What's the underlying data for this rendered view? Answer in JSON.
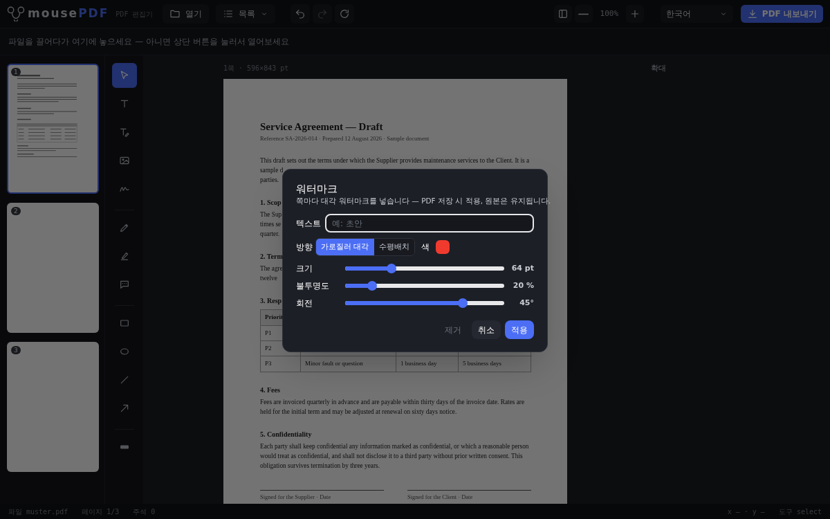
{
  "app": {
    "logo_first": "mouse",
    "logo_second": "PDF",
    "subtitle": "PDF 편집기"
  },
  "toolbar": {
    "open": "열기",
    "list": "목록",
    "zoom": "100%",
    "language": "한국어",
    "export": "PDF 내보내기"
  },
  "hint_bar": "파일을 끌어다가 여기에 놓으세요 — 아니면 상단 버튼을 눌러서 열어보세요",
  "thumbnails": [
    {
      "number": "1",
      "selected": true,
      "kind": "document"
    },
    {
      "number": "2",
      "selected": false,
      "kind": "blank"
    },
    {
      "number": "3",
      "selected": false,
      "kind": "blank"
    }
  ],
  "tool_groups": [
    [
      {
        "kind": "select",
        "selected": true
      },
      {
        "kind": "text",
        "selected": false
      },
      {
        "kind": "edit-text",
        "selected": false
      },
      {
        "kind": "image",
        "selected": false
      },
      {
        "kind": "signature",
        "selected": false
      }
    ],
    [
      {
        "kind": "pen",
        "selected": false
      },
      {
        "kind": "highlighter",
        "selected": false
      },
      {
        "kind": "comment",
        "selected": false
      }
    ],
    [
      {
        "kind": "rectangle",
        "selected": false
      },
      {
        "kind": "ellipse",
        "selected": false
      },
      {
        "kind": "line",
        "selected": false
      },
      {
        "kind": "arrow",
        "selected": false
      }
    ],
    [
      {
        "kind": "redact",
        "selected": false
      }
    ]
  ],
  "page": {
    "label": "1쪽 · 596×843 pt",
    "right_label": "확대"
  },
  "document": {
    "title": "Service Agreement — Draft",
    "reference": "Reference SA-2026-014 · Prepared 12 August 2026 · Sample document",
    "blocks": [
      {
        "kind": "paragraph",
        "lines": [
          "This draft sets out the terms under which the Supplier provides maintenance services to the Client. It is a",
          "sample d",
          "parties."
        ]
      },
      {
        "kind": "heading",
        "text": "1. Scop"
      },
      {
        "kind": "paragraph",
        "lines": [
          "The Sup",
          "times se",
          "quarter."
        ]
      },
      {
        "kind": "heading",
        "text": "2. Term"
      },
      {
        "kind": "paragraph",
        "lines": [
          "The agre",
          "twelve"
        ]
      },
      {
        "kind": "heading",
        "text": "3. Resp"
      },
      {
        "kind": "table",
        "header": [
          "Priorit"
        ],
        "rows": [
          [
            "P1"
          ],
          [
            "P2"
          ],
          [
            "P3",
            "Minor fault or question",
            "1 business day",
            "5 business days"
          ]
        ]
      },
      {
        "kind": "heading",
        "text": "4. Fees"
      },
      {
        "kind": "paragraph",
        "lines": [
          "Fees are invoiced quarterly in advance and are payable within thirty days of the invoice date. Rates are",
          "held for the initial term and may be adjusted at renewal on sixty days notice."
        ]
      },
      {
        "kind": "heading",
        "text": "5. Confidentiality"
      },
      {
        "kind": "paragraph",
        "lines": [
          "Each party shall keep confidential any information marked as confidential, or which a reasonable person",
          "would treat as confidential, and shall not disclose it to a third party without prior written consent. This",
          "obligation survives termination by three years."
        ]
      },
      {
        "kind": "signatures",
        "captions": [
          "Signed for the Supplier · Date",
          "Signed for the Client · Date"
        ]
      }
    ]
  },
  "dialog": {
    "title": "워터마크",
    "description": "쪽마다 대각 워터마크를 넣습니다 — PDF 저장 시 적용, 원본은 유지됩니다.",
    "text_label": "텍스트",
    "placeholder": "예: 초안",
    "direction_label": "방향",
    "directions": [
      {
        "label": "가로질러 대각",
        "selected": true
      },
      {
        "label": "수평배치",
        "selected": false
      }
    ],
    "color_label": "색",
    "color": "#f03a2e",
    "sliders": [
      {
        "label": "크기",
        "level": 0.29,
        "reading": "64 pt"
      },
      {
        "label": "불투명도",
        "level": 0.17,
        "reading": "20 %"
      },
      {
        "label": "회전",
        "level": 0.74,
        "reading": "45°"
      }
    ],
    "buttons": [
      {
        "label": "제거",
        "kind": "ghost"
      },
      {
        "label": "취소",
        "kind": "secondary"
      },
      {
        "label": "적용",
        "kind": "primary"
      }
    ]
  },
  "status_bar": {
    "file_label": "파일",
    "file": "muster.pdf",
    "page_label": "페이지",
    "page": "1/3",
    "notes_label": "주석",
    "notes": "0",
    "coords": "x — · y —",
    "tool_label": "도구",
    "tool": "select"
  }
}
